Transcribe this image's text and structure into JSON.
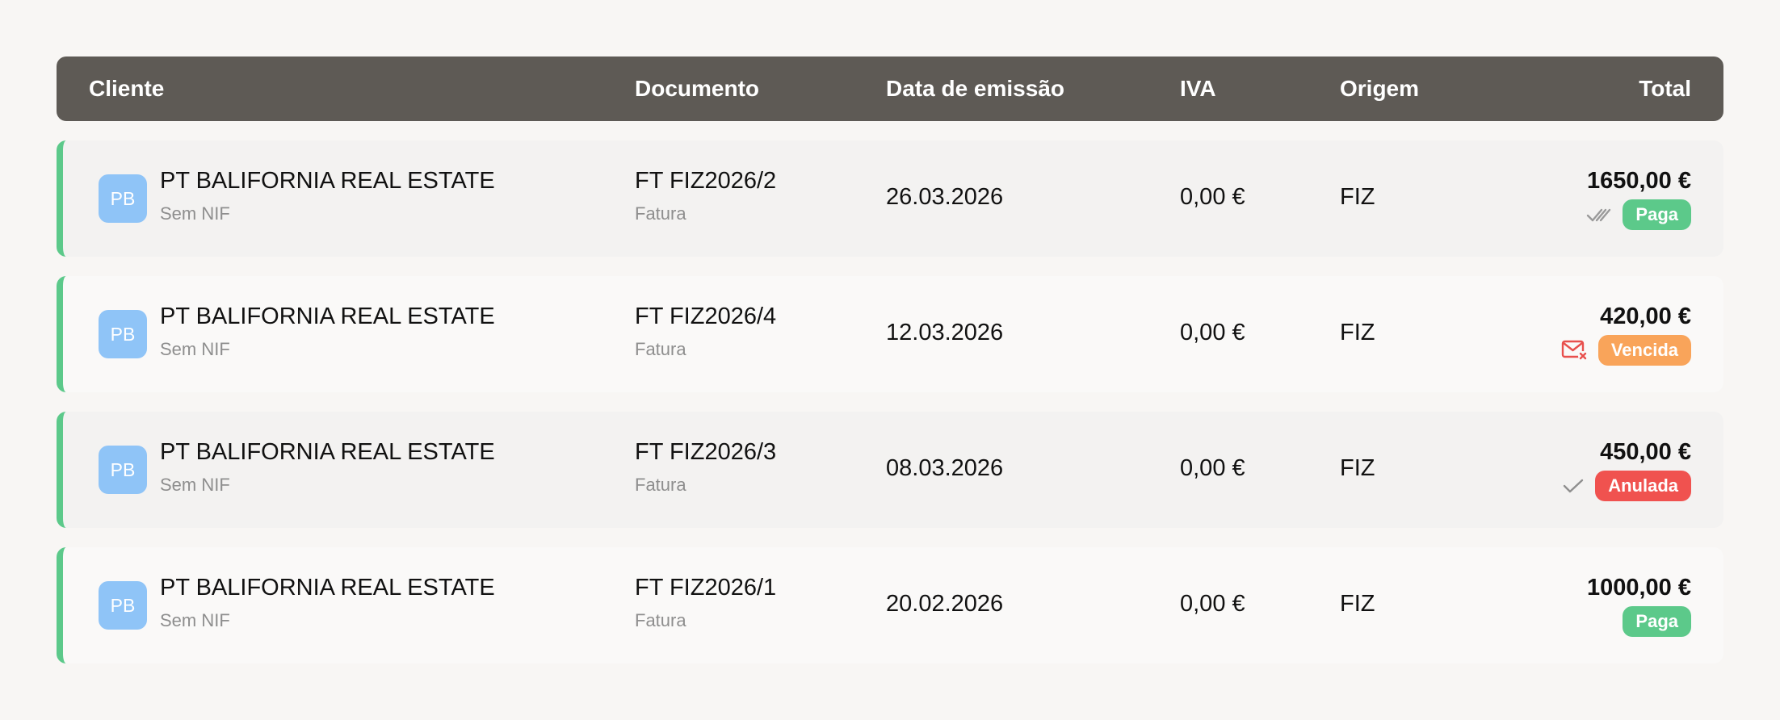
{
  "header": {
    "cliente": "Cliente",
    "documento": "Documento",
    "data_emissao": "Data de emissão",
    "iva": "IVA",
    "origem": "Origem",
    "total": "Total"
  },
  "colors": {
    "header_bg": "#5e5a55",
    "accent_bar": "#5cc98a",
    "avatar_bg": "#8fc4f7",
    "paga": "#5cc98a",
    "vencida": "#f9a45a",
    "anulada": "#f0524f"
  },
  "rows": [
    {
      "avatar": "PB",
      "client": "PT BALIFORNIA REAL ESTATE",
      "nif": "Sem NIF",
      "doc_number": "FT FIZ2026/2",
      "doc_type": "Fatura",
      "date": "26.03.2026",
      "iva": "0,00 €",
      "origin": "FIZ",
      "total": "1650,00 €",
      "status": "Paga",
      "status_icon": "double-check-icon"
    },
    {
      "avatar": "PB",
      "client": "PT BALIFORNIA REAL ESTATE",
      "nif": "Sem NIF",
      "doc_number": "FT FIZ2026/4",
      "doc_type": "Fatura",
      "date": "12.03.2026",
      "iva": "0,00 €",
      "origin": "FIZ",
      "total": "420,00 €",
      "status": "Vencida",
      "status_icon": "mail-error-icon"
    },
    {
      "avatar": "PB",
      "client": "PT BALIFORNIA REAL ESTATE",
      "nif": "Sem NIF",
      "doc_number": "FT FIZ2026/3",
      "doc_type": "Fatura",
      "date": "08.03.2026",
      "iva": "0,00 €",
      "origin": "FIZ",
      "total": "450,00 €",
      "status": "Anulada",
      "status_icon": "check-icon"
    },
    {
      "avatar": "PB",
      "client": "PT BALIFORNIA REAL ESTATE",
      "nif": "Sem NIF",
      "doc_number": "FT FIZ2026/1",
      "doc_type": "Fatura",
      "date": "20.02.2026",
      "iva": "0,00 €",
      "origin": "FIZ",
      "total": "1000,00 €",
      "status": "Paga",
      "status_icon": ""
    }
  ]
}
